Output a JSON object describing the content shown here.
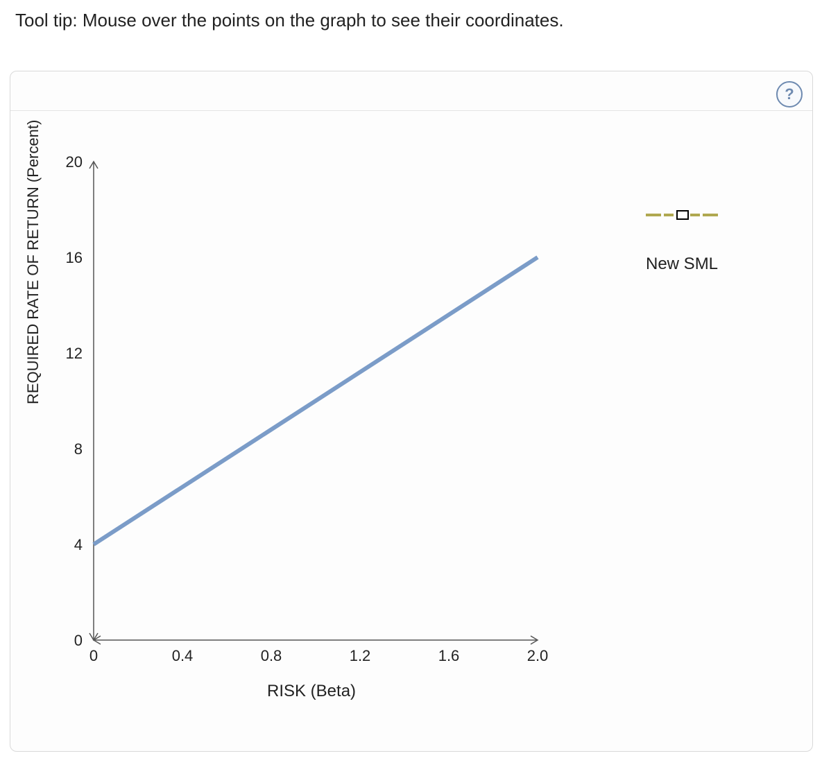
{
  "tooltip_text": "Tool tip: Mouse over the points on the graph to see their coordinates.",
  "help_icon_label": "?",
  "ylabel": "REQUIRED RATE OF RETURN (Percent)",
  "xlabel": "RISK (Beta)",
  "legend": {
    "series1": "New SML"
  },
  "yticks": {
    "t0": "0",
    "t4": "4",
    "t8": "8",
    "t12": "12",
    "t16": "16",
    "t20": "20"
  },
  "xticks": {
    "t0": "0",
    "t04": "0.4",
    "t08": "0.8",
    "t12": "1.2",
    "t16": "1.6",
    "t20": "2.0"
  },
  "chart_data": {
    "type": "line",
    "title": "",
    "xlabel": "RISK (Beta)",
    "ylabel": "REQUIRED RATE OF RETURN (Percent)",
    "xlim": [
      0,
      2.0
    ],
    "ylim": [
      0,
      20
    ],
    "series": [
      {
        "name": "New SML",
        "x": [
          0,
          2.0
        ],
        "y": [
          4,
          16
        ],
        "color": "#7b9cc8"
      }
    ],
    "legend_series": [
      {
        "name": "",
        "style": "dashed-with-square-marker",
        "color": "#b0a850"
      },
      {
        "name": "New SML"
      }
    ]
  }
}
